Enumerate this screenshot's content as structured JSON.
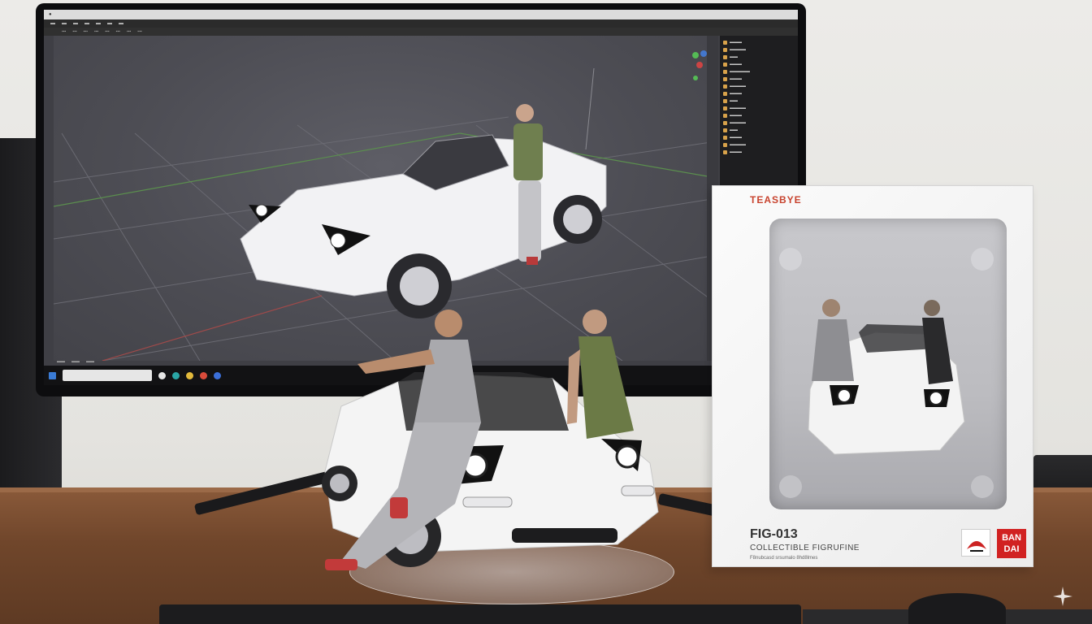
{
  "box": {
    "brand": "TEASBYE",
    "model": "FIG-013",
    "subtitle": "COLLECTIBLE FIGRUFINE",
    "fine_print": "F8nubcasd srsumalo 8hd8lmes",
    "publisher": "BAN DAI"
  },
  "colors": {
    "accent_red": "#d12222",
    "viewport_gray": "#4d4d54",
    "desk_wood": "#70462b"
  }
}
